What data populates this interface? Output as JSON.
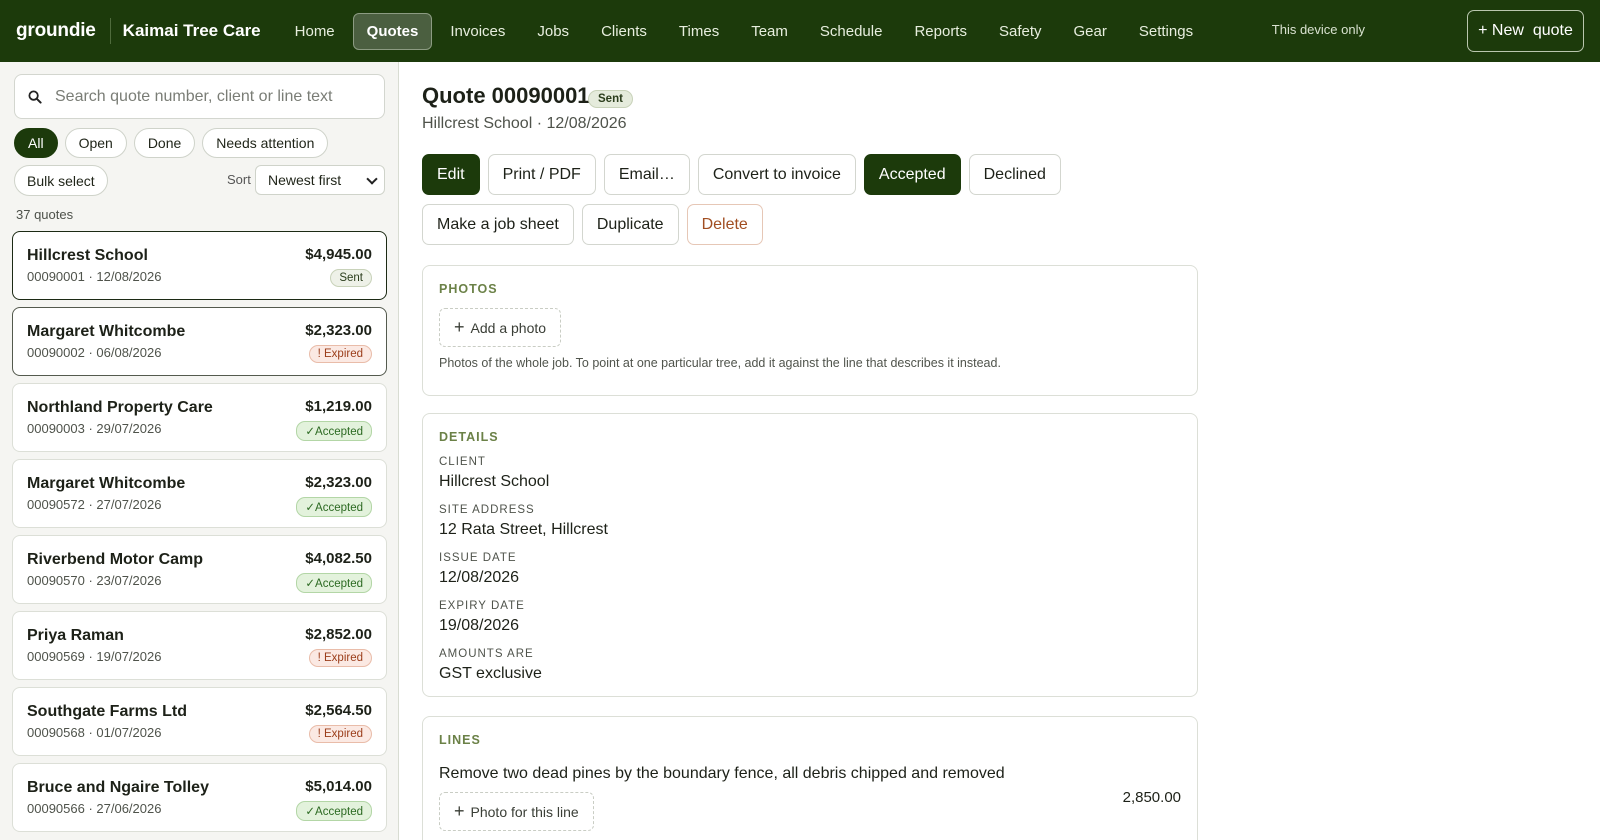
{
  "topbar": {
    "brand": "groundie",
    "org": "Kaimai Tree Care",
    "nav": [
      "Home",
      "Quotes",
      "Invoices",
      "Jobs",
      "Clients",
      "Times",
      "Team",
      "Schedule",
      "Reports",
      "Safety",
      "Gear",
      "Settings"
    ],
    "active_nav": "Quotes",
    "device_note": "This device only",
    "new_quote": "+ New  quote"
  },
  "sidebar": {
    "search_placeholder": "Search quote number, client or line text",
    "filters": [
      "All",
      "Open",
      "Done",
      "Needs attention"
    ],
    "active_filter": "All",
    "bulk_select": "Bulk select",
    "sort_label": "Sort",
    "sort_value": "Newest first",
    "count": "37 quotes",
    "quotes": [
      {
        "name": "Hillcrest School",
        "meta": "00090001 · 12/08/2026",
        "amount": "$4,945.00",
        "status": "Sent",
        "kind": "sent"
      },
      {
        "name": "Margaret Whitcombe",
        "meta": "00090002 · 06/08/2026",
        "amount": "$2,323.00",
        "status": "! Expired",
        "kind": "expired"
      },
      {
        "name": "Northland Property Care",
        "meta": "00090003 · 29/07/2026",
        "amount": "$1,219.00",
        "status": "✓Accepted",
        "kind": "accepted"
      },
      {
        "name": "Margaret Whitcombe",
        "meta": "00090572 · 27/07/2026",
        "amount": "$2,323.00",
        "status": "✓Accepted",
        "kind": "accepted"
      },
      {
        "name": "Riverbend Motor Camp",
        "meta": "00090570 · 23/07/2026",
        "amount": "$4,082.50",
        "status": "✓Accepted",
        "kind": "accepted"
      },
      {
        "name": "Priya Raman",
        "meta": "00090569 · 19/07/2026",
        "amount": "$2,852.00",
        "status": "! Expired",
        "kind": "expired"
      },
      {
        "name": "Southgate Farms Ltd",
        "meta": "00090568 · 01/07/2026",
        "amount": "$2,564.50",
        "status": "! Expired",
        "kind": "expired"
      },
      {
        "name": "Bruce and Ngaire Tolley",
        "meta": "00090566 · 27/06/2026",
        "amount": "$5,014.00",
        "status": "✓Accepted",
        "kind": "accepted"
      }
    ]
  },
  "quote": {
    "title": "Quote 00090001",
    "status": "Sent",
    "subtitle": "Hillcrest School · 12/08/2026",
    "actions": [
      {
        "label": "Edit",
        "style": "dark"
      },
      {
        "label": "Print / PDF",
        "style": "plain"
      },
      {
        "label": "Email…",
        "style": "plain"
      },
      {
        "label": "Convert to invoice",
        "style": "plain"
      },
      {
        "label": "Accepted",
        "style": "dark"
      },
      {
        "label": "Declined",
        "style": "plain"
      },
      {
        "label": "Make a job sheet",
        "style": "plain"
      },
      {
        "label": "Duplicate",
        "style": "plain"
      },
      {
        "label": "Delete",
        "style": "danger"
      }
    ],
    "photos": {
      "heading": "PHOTOS",
      "add_label": "Add a photo",
      "note": "Photos of the whole job. To point at one particular tree, add it against the line that describes it instead."
    },
    "details": {
      "heading": "DETAILS",
      "fields": [
        {
          "label": "CLIENT",
          "value": "Hillcrest School"
        },
        {
          "label": "SITE ADDRESS",
          "value": "12 Rata Street, Hillcrest"
        },
        {
          "label": "ISSUE DATE",
          "value": "12/08/2026"
        },
        {
          "label": "EXPIRY DATE",
          "value": "19/08/2026"
        },
        {
          "label": "AMOUNTS ARE",
          "value": "GST exclusive"
        }
      ]
    },
    "lines": {
      "heading": "LINES",
      "items": [
        {
          "text": "Remove two dead pines by the boundary fence, all debris chipped and removed",
          "amount": "2,850.00",
          "photo_label": "Photo for this line"
        }
      ]
    }
  },
  "colors": {
    "brand_dark": "#1c3a0b",
    "accent_heading": "#6b8147",
    "expired": "#9b3d1a",
    "accepted": "#2c6a22"
  }
}
